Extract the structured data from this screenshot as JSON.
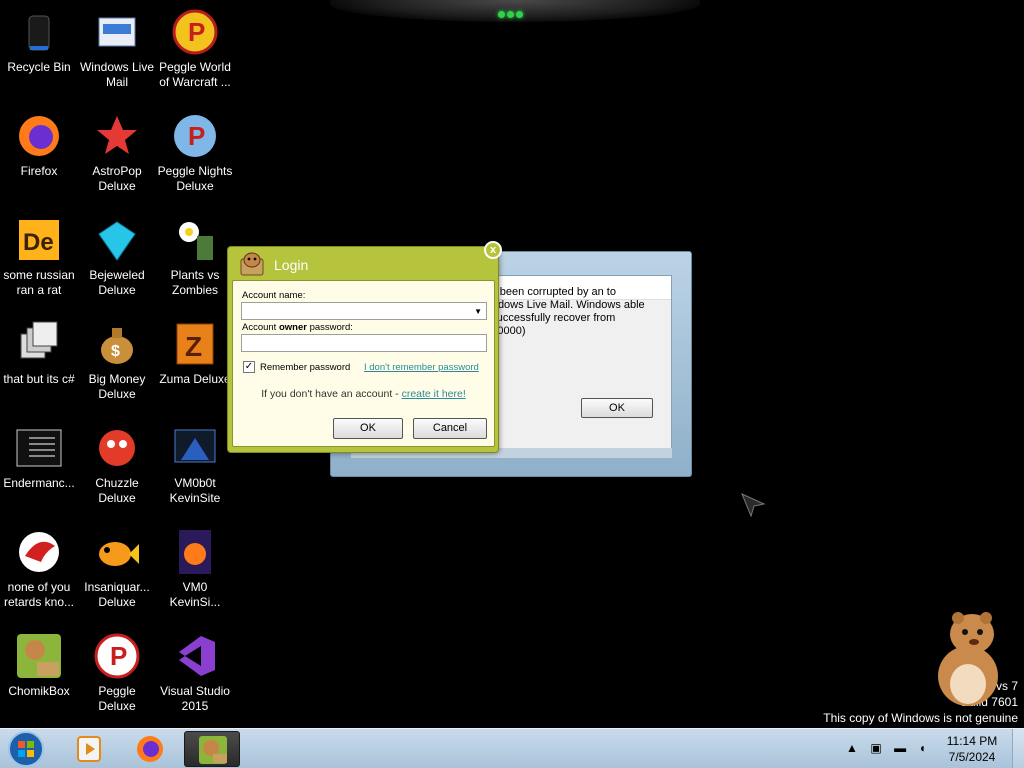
{
  "desktop": {
    "icons": [
      {
        "label": "Recycle Bin",
        "icon": "recycle-bin-icon"
      },
      {
        "label": "Windows Live Mail",
        "icon": "windows-live-mail-icon"
      },
      {
        "label": "Peggle World of Warcraft ...",
        "icon": "peggle-icon"
      },
      {
        "label": "Firefox",
        "icon": "firefox-icon"
      },
      {
        "label": "AstroPop Deluxe",
        "icon": "astropop-icon"
      },
      {
        "label": "Peggle Nights Deluxe",
        "icon": "peggle-nights-icon"
      },
      {
        "label": "some russian ran a rat",
        "icon": "de-icon"
      },
      {
        "label": "Bejeweled Deluxe",
        "icon": "bejeweled-icon"
      },
      {
        "label": "Plants vs Zombies",
        "icon": "plants-vs-zombies-icon"
      },
      {
        "label": "that but its c#",
        "icon": "windows-stack-icon"
      },
      {
        "label": "Big Money Deluxe",
        "icon": "money-bag-icon"
      },
      {
        "label": "Zuma Deluxe",
        "icon": "zuma-icon"
      },
      {
        "label": "Endermanc...",
        "icon": "terminal-icon"
      },
      {
        "label": "Chuzzle Deluxe",
        "icon": "chuzzle-icon"
      },
      {
        "label": "VM0b0t KevinSite",
        "icon": "vm-folder-icon"
      },
      {
        "label": "none of you retards kno...",
        "icon": "bird-icon"
      },
      {
        "label": "Insaniquar... Deluxe",
        "icon": "fish-icon"
      },
      {
        "label": "VM0 KevinSi...",
        "icon": "firefox-file-icon"
      },
      {
        "label": "ChomikBox",
        "icon": "chomikbox-icon"
      },
      {
        "label": "Peggle Deluxe",
        "icon": "peggle-deluxe-icon"
      },
      {
        "label": "Visual Studio 2015",
        "icon": "visual-studio-icon"
      }
    ]
  },
  "error_dialog": {
    "message": "has been corrupted by an to Windows Live Mail. Windows able to successfully recover from 0000000)",
    "ok_label": "OK"
  },
  "login": {
    "title": "Login",
    "close_label": "x",
    "account_name_label": "Account name:",
    "account_name_value": "",
    "password_label_prefix": "Account ",
    "password_label_bold": "owner",
    "password_label_suffix": " password:",
    "password_value": "",
    "remember_label": "Remember password",
    "remember_checked": true,
    "forgot_link": "I don't remember password",
    "no_account_text": "If you don't have an account - ",
    "create_link": "create it here!",
    "ok_label": "OK",
    "cancel_label": "Cancel"
  },
  "watermark": {
    "line1": "vs 7",
    "line2": "Build 7601",
    "line3": "This copy of Windows is not genuine"
  },
  "taskbar": {
    "clock_time": "11:14 PM",
    "clock_date": "7/5/2024",
    "tray_arrow": "▲"
  },
  "colors": {
    "login_green": "#b6c33c",
    "link_teal": "#2a8a9a",
    "taskbar": "#b9cfe3"
  }
}
